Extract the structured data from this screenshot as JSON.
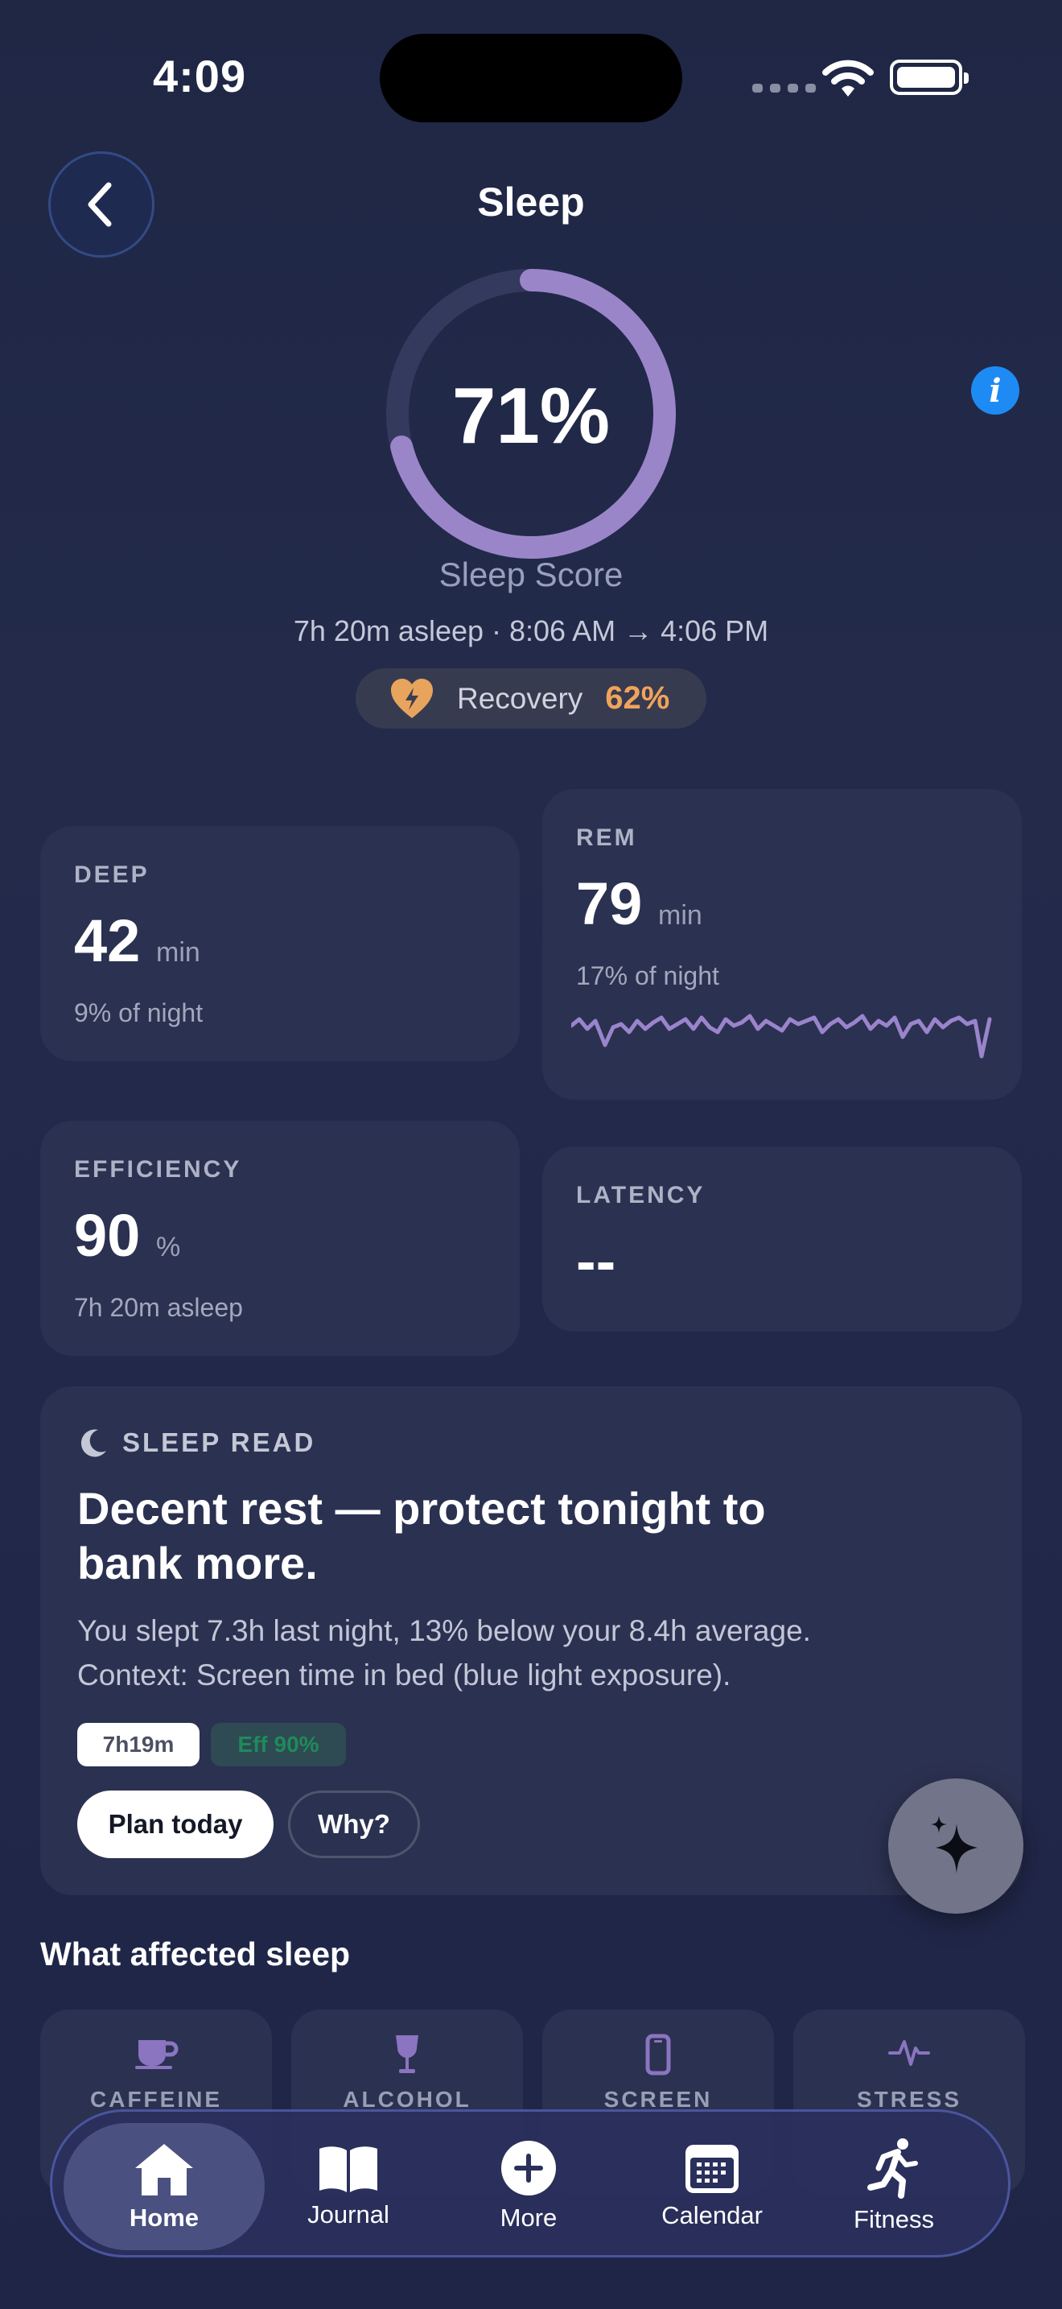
{
  "status": {
    "time": "4:09"
  },
  "header": {
    "title": "Sleep"
  },
  "score": {
    "value": "71%",
    "fraction": 0.71,
    "label": "Sleep Score",
    "ring_color": "#9b85c9"
  },
  "summary": "7h 20m asleep · 8:06 AM → 4:06 PM",
  "recovery": {
    "label": "Recovery",
    "value": "62%",
    "color": "#f1a35a"
  },
  "metrics": {
    "deep": {
      "kicker": "DEEP",
      "value": "42",
      "unit": "min",
      "sub": "9% of night"
    },
    "rem": {
      "kicker": "REM",
      "value": "79",
      "unit": "min",
      "sub": "17% of night"
    },
    "efficiency": {
      "kicker": "EFFICIENCY",
      "value": "90",
      "unit": "%",
      "sub": "7h 20m asleep"
    },
    "latency": {
      "kicker": "LATENCY",
      "value": "--"
    }
  },
  "sleep_read": {
    "kicker": "SLEEP READ",
    "headline_line1": "Decent rest — protect tonight to",
    "headline_line2": "bank more.",
    "body_line1": "You slept 7.3h last night, 13% below your 8.4h average.",
    "body_line2": "Context: Screen time in bed (blue light exposure).",
    "chip_duration": "7h19m",
    "chip_efficiency": "Eff 90%",
    "plan_button": "Plan today",
    "why_button": "Why?"
  },
  "affected": {
    "title": "What affected sleep",
    "factors": [
      {
        "label": "CAFFEINE",
        "icon": "coffee-cup-icon"
      },
      {
        "label": "ALCOHOL",
        "icon": "wine-glass-icon"
      },
      {
        "label": "SCREEN",
        "icon": "phone-icon"
      },
      {
        "label": "STRESS",
        "icon": "pulse-icon"
      }
    ]
  },
  "tabs": [
    {
      "label": "Home",
      "icon": "home-icon",
      "active": true
    },
    {
      "label": "Journal",
      "icon": "book-icon",
      "active": false
    },
    {
      "label": "More",
      "icon": "plus-circle-icon",
      "active": false
    },
    {
      "label": "Calendar",
      "icon": "calendar-icon",
      "active": false
    },
    {
      "label": "Fitness",
      "icon": "runner-icon",
      "active": false
    }
  ]
}
